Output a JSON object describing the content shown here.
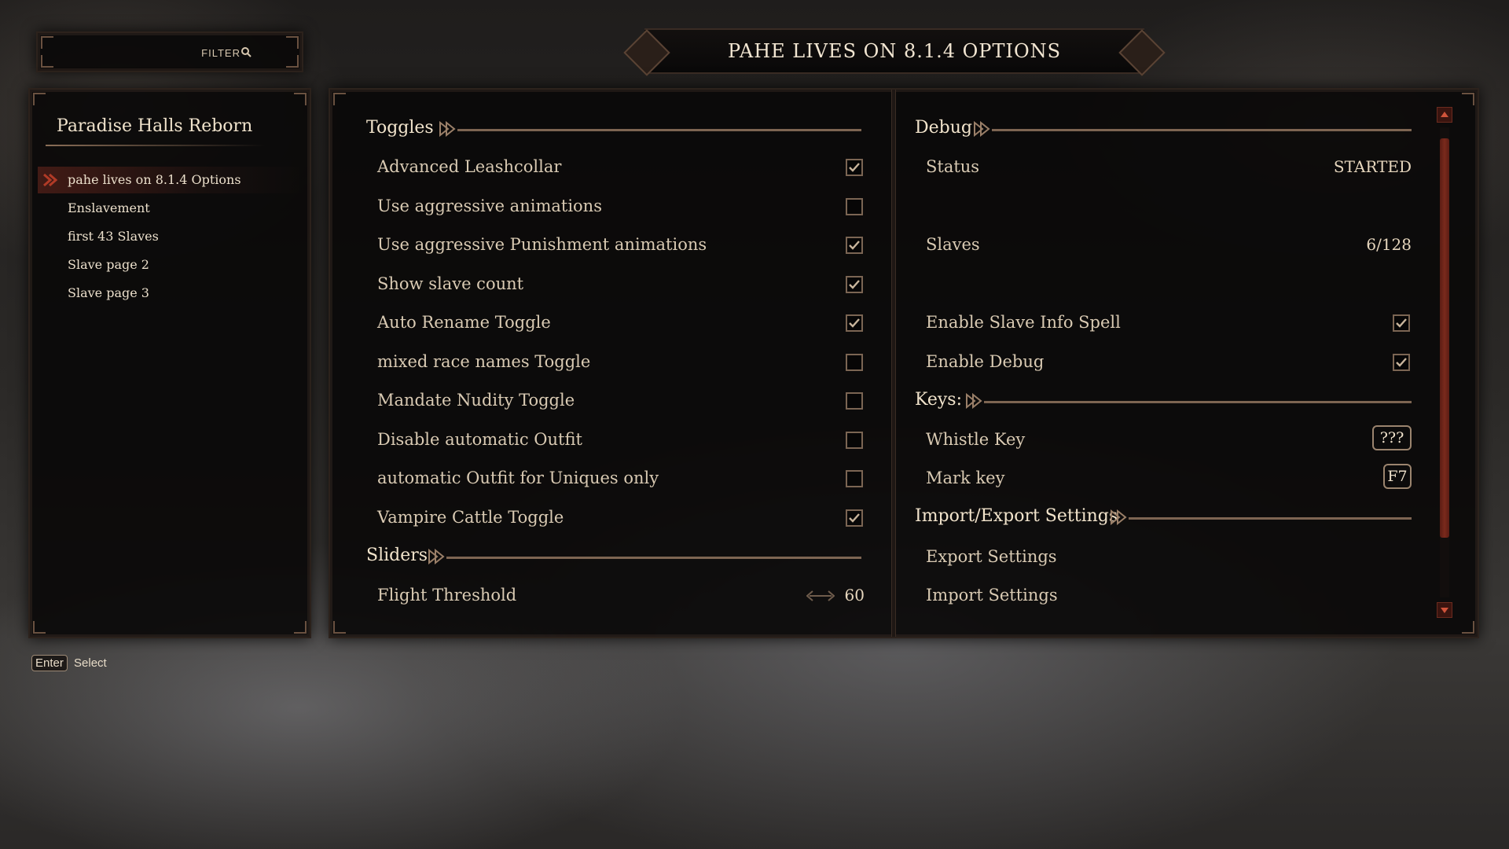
{
  "filter": {
    "label": "FILTER"
  },
  "title": "PAHE LIVES ON 8.1.4 OPTIONS",
  "sidebar": {
    "mod_name": "Paradise Halls Reborn",
    "pages": [
      {
        "label": "pahe lives on 8.1.4 Options",
        "selected": true
      },
      {
        "label": "Enslavement",
        "selected": false
      },
      {
        "label": "first 43 Slaves",
        "selected": false
      },
      {
        "label": "Slave page 2",
        "selected": false
      },
      {
        "label": "Slave page 3",
        "selected": false
      }
    ]
  },
  "left_column": {
    "toggles_header": "Toggles",
    "toggles": [
      {
        "label": "Advanced Leashcollar",
        "checked": true
      },
      {
        "label": "Use aggressive animations",
        "checked": false
      },
      {
        "label": "Use aggressive Punishment animations",
        "checked": true
      },
      {
        "label": "Show slave count",
        "checked": true
      },
      {
        "label": "Auto Rename Toggle",
        "checked": true
      },
      {
        "label": "mixed race names Toggle",
        "checked": false
      },
      {
        "label": "Mandate Nudity Toggle",
        "checked": false
      },
      {
        "label": "Disable automatic Outfit",
        "checked": false
      },
      {
        "label": "automatic Outfit for Uniques only",
        "checked": false
      },
      {
        "label": "Vampire Cattle Toggle",
        "checked": true
      }
    ],
    "sliders_header": "Sliders",
    "sliders": [
      {
        "label": "Flight Threshold",
        "value": "60"
      }
    ]
  },
  "right_column": {
    "debug_header": "Debug",
    "status_label": "Status",
    "status_value": "STARTED",
    "slaves_label": "Slaves",
    "slaves_value": "6/128",
    "debug_toggles": [
      {
        "label": "Enable Slave Info Spell",
        "checked": true
      },
      {
        "label": "Enable Debug",
        "checked": true
      }
    ],
    "keys_header": "Keys:",
    "keys": [
      {
        "label": "Whistle Key",
        "key": "???"
      },
      {
        "label": "Mark key",
        "key": "F7"
      }
    ],
    "import_export_header": "Import/Export Settings",
    "export_label": "Export Settings",
    "import_label": "Import Settings"
  },
  "footer": {
    "key": "Enter",
    "action": "Select"
  },
  "colors": {
    "accent": "#7d6552",
    "selection": "#6e281e",
    "text": "#e6d6bd",
    "scroll": "#7a2a1c"
  }
}
